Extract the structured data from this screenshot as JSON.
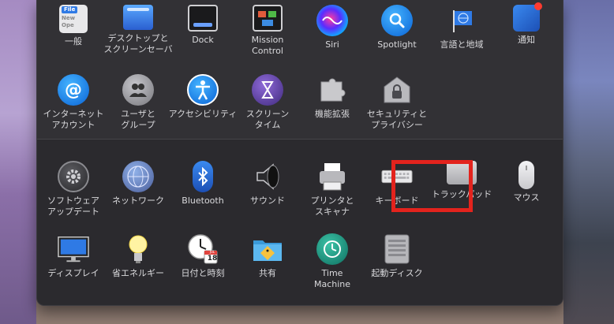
{
  "rows": [
    [
      {
        "id": "general",
        "label": "一般",
        "icon": "general-icon"
      },
      {
        "id": "desktop",
        "label": "デスクトップと\nスクリーンセーバ",
        "icon": "desktop-screensaver-icon"
      },
      {
        "id": "dock",
        "label": "Dock",
        "icon": "dock-icon"
      },
      {
        "id": "mission",
        "label": "Mission\nControl",
        "icon": "mission-control-icon"
      },
      {
        "id": "siri",
        "label": "Siri",
        "icon": "siri-icon"
      },
      {
        "id": "spotlight",
        "label": "Spotlight",
        "icon": "spotlight-icon"
      },
      {
        "id": "language",
        "label": "言語と地域",
        "icon": "language-region-icon"
      },
      {
        "id": "notifications",
        "label": "通知",
        "icon": "notifications-icon"
      }
    ],
    [
      {
        "id": "internet",
        "label": "インターネット\nアカウント",
        "icon": "internet-accounts-icon"
      },
      {
        "id": "users",
        "label": "ユーザと\nグループ",
        "icon": "users-groups-icon"
      },
      {
        "id": "accessibility",
        "label": "アクセシビリティ",
        "icon": "accessibility-icon"
      },
      {
        "id": "screentime",
        "label": "スクリーン\nタイム",
        "icon": "screen-time-icon"
      },
      {
        "id": "extensions",
        "label": "機能拡張",
        "icon": "extensions-icon"
      },
      {
        "id": "security",
        "label": "セキュリティと\nプライバシー",
        "icon": "security-privacy-icon"
      }
    ],
    [
      {
        "id": "software",
        "label": "ソフトウェア\nアップデート",
        "icon": "software-update-icon"
      },
      {
        "id": "network",
        "label": "ネットワーク",
        "icon": "network-icon"
      },
      {
        "id": "bluetooth",
        "label": "Bluetooth",
        "icon": "bluetooth-icon"
      },
      {
        "id": "sound",
        "label": "サウンド",
        "icon": "sound-icon"
      },
      {
        "id": "printers",
        "label": "プリンタと\nスキャナ",
        "icon": "printers-scanners-icon"
      },
      {
        "id": "keyboard",
        "label": "キーボード",
        "icon": "keyboard-icon"
      },
      {
        "id": "trackpad",
        "label": "トラックパッド",
        "icon": "trackpad-icon"
      },
      {
        "id": "mouse",
        "label": "マウス",
        "icon": "mouse-icon"
      }
    ],
    [
      {
        "id": "displays",
        "label": "ディスプレイ",
        "icon": "displays-icon"
      },
      {
        "id": "energy",
        "label": "省エネルギー",
        "icon": "energy-saver-icon"
      },
      {
        "id": "datetime",
        "label": "日付と時刻",
        "icon": "date-time-icon"
      },
      {
        "id": "sharing",
        "label": "共有",
        "icon": "sharing-icon"
      },
      {
        "id": "timemachine",
        "label": "Time\nMachine",
        "icon": "time-machine-icon"
      },
      {
        "id": "startup",
        "label": "起動ディスク",
        "icon": "startup-disk-icon"
      }
    ]
  ],
  "icon_text": {
    "general_file": "File",
    "general_new": "New",
    "general_ope": "Ope",
    "calendar_day": "18",
    "calendar_month": "JUL"
  },
  "colors": {
    "highlight": "#e3231d",
    "window_bg": "#2b2a2e",
    "label": "#d9d9dc"
  }
}
